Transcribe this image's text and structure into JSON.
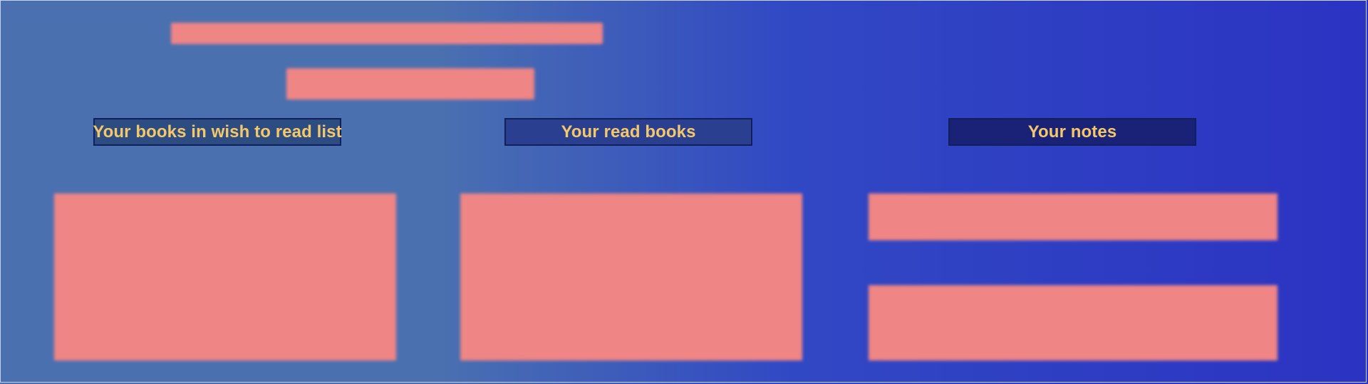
{
  "sections": {
    "wish_list": {
      "label": "Your books in wish to read list"
    },
    "read_books": {
      "label": "Your read books"
    },
    "notes": {
      "label": "Your notes"
    }
  },
  "colors": {
    "background_left": "#4a70b0",
    "background_right": "#2b33c2",
    "header_text": "#f4c86a",
    "header_border": "#10205c",
    "placeholder_block": "#ef8585"
  }
}
